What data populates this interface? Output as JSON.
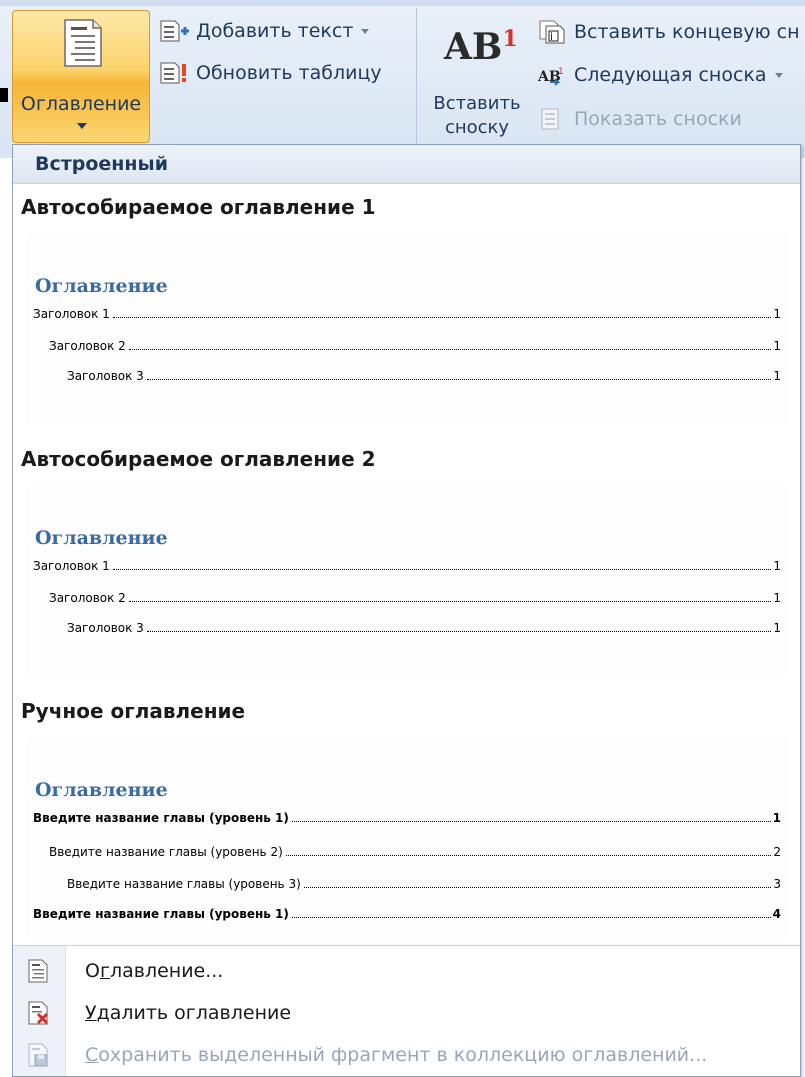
{
  "ribbon": {
    "toc_button": {
      "label": "Оглавление"
    },
    "add_text": {
      "label": "Добавить текст"
    },
    "update_table": {
      "label": "Обновить таблицу"
    },
    "insert_footnote": {
      "icon_text": "AB",
      "icon_sup": "1",
      "label_line1": "Вставить",
      "label_line2": "сноску"
    },
    "insert_endnote": {
      "label": "Вставить концевую сн"
    },
    "next_footnote": {
      "label": "Следующая сноска"
    },
    "show_notes": {
      "label": "Показать сноски"
    }
  },
  "gallery": {
    "header": "Встроенный",
    "sections": [
      {
        "title": "Автособираемое оглавление 1",
        "preview_title": "Оглавление",
        "entries": [
          {
            "text": "Заголовок 1",
            "page": "1"
          },
          {
            "text": "Заголовок 2",
            "page": "1"
          },
          {
            "text": "Заголовок 3",
            "page": "1"
          }
        ]
      },
      {
        "title": "Автособираемое оглавление 2",
        "preview_title": "Оглавление",
        "entries": [
          {
            "text": "Заголовок 1",
            "page": "1"
          },
          {
            "text": "Заголовок 2",
            "page": "1"
          },
          {
            "text": "Заголовок 3",
            "page": "1"
          }
        ]
      },
      {
        "title": "Ручное оглавление",
        "preview_title": "Оглавление",
        "entries": [
          {
            "text": "Введите название главы (уровень 1)",
            "page": "1"
          },
          {
            "text": "Введите название главы (уровень 2)",
            "page": "2"
          },
          {
            "text": "Введите название главы (уровень 3)",
            "page": "3"
          },
          {
            "text": "Введите название главы (уровень 1)",
            "page": "4"
          }
        ]
      }
    ]
  },
  "menu": {
    "toc_dialog": {
      "pre": "О",
      "mnemonic": "г",
      "post": "лавление..."
    },
    "remove_toc": {
      "mnemonic": "У",
      "post": "далить оглавление"
    },
    "save_selection": {
      "mnemonic": "С",
      "post": "охранить выделенный фрагмент в коллекцию оглавлений..."
    }
  }
}
